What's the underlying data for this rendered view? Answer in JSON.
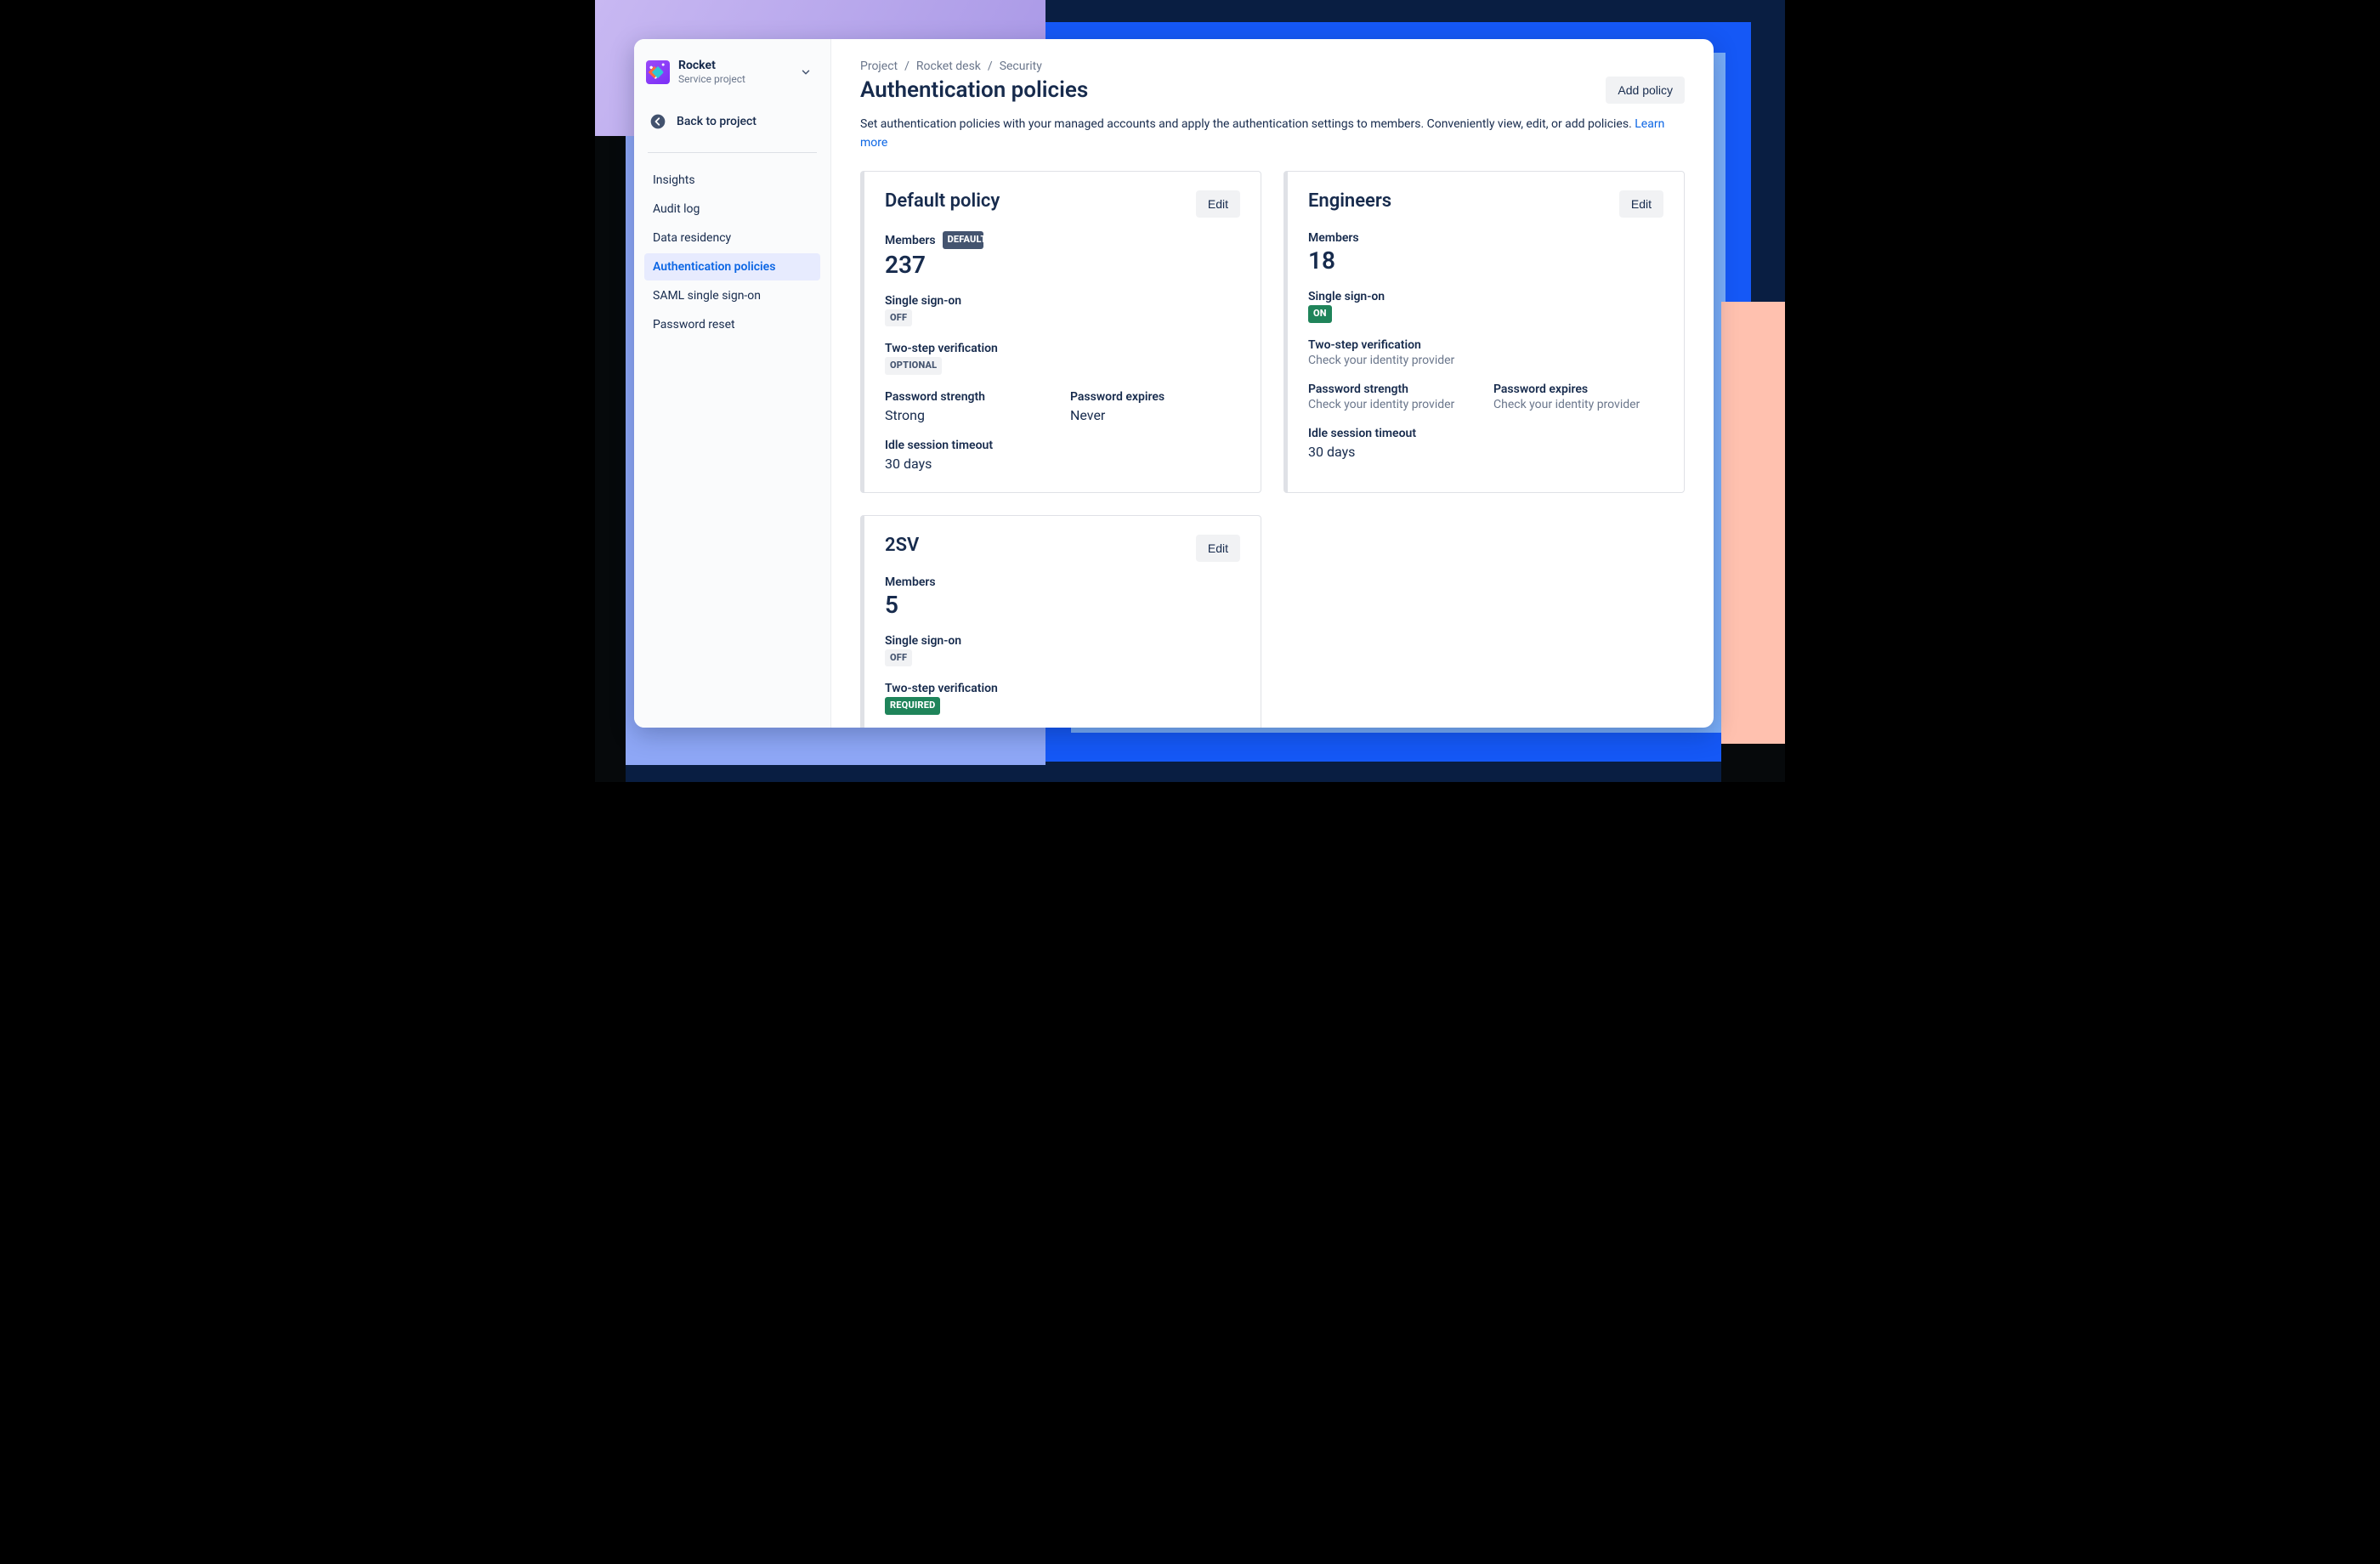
{
  "sidebar": {
    "project": {
      "name": "Rocket",
      "sub": "Service project"
    },
    "back_label": "Back to project",
    "items": [
      {
        "label": "Insights"
      },
      {
        "label": "Audit log"
      },
      {
        "label": "Data residency"
      },
      {
        "label": "Authentication policies",
        "active": true
      },
      {
        "label": "SAML single sign-on"
      },
      {
        "label": "Password reset"
      }
    ]
  },
  "breadcrumbs": [
    "Project",
    "Rocket desk",
    "Security"
  ],
  "page": {
    "title": "Authentication policies",
    "add_button": "Add policy",
    "description": "Set authentication policies with your managed accounts and apply the authentication settings to members. Conveniently view, edit, or add policies.",
    "learn_more": "Learn more"
  },
  "policies": [
    {
      "title": "Default policy",
      "edit": "Edit",
      "default_badge": "DEFAULT",
      "members_label": "Members",
      "members": "237",
      "sso_label": "Single sign-on",
      "sso_badge": "OFF",
      "sso_style": "lz-default",
      "twosv_label": "Two-step verification",
      "twosv_badge": "OPTIONAL",
      "twosv_style": "lz-default",
      "pw_strength_label": "Password strength",
      "pw_strength_value": "Strong",
      "pw_exp_label": "Password expires",
      "pw_exp_value": "Never",
      "idle_label": "Idle session timeout",
      "idle_value": "30 days"
    },
    {
      "title": "Engineers",
      "edit": "Edit",
      "members_label": "Members",
      "members": "18",
      "sso_label": "Single sign-on",
      "sso_badge": "ON",
      "sso_style": "lz-green",
      "twosv_label": "Two-step verification",
      "twosv_note": "Check your identity provider",
      "pw_strength_label": "Password strength",
      "pw_strength_note": "Check your identity provider",
      "pw_exp_label": "Password expires",
      "pw_exp_note": "Check your identity provider",
      "idle_label": "Idle session timeout",
      "idle_value": "30 days"
    },
    {
      "title": "2SV",
      "edit": "Edit",
      "members_label": "Members",
      "members": "5",
      "sso_label": "Single sign-on",
      "sso_badge": "OFF",
      "sso_style": "lz-default",
      "twosv_label": "Two-step verification",
      "twosv_badge": "REQUIRED",
      "twosv_style": "lz-green"
    }
  ]
}
